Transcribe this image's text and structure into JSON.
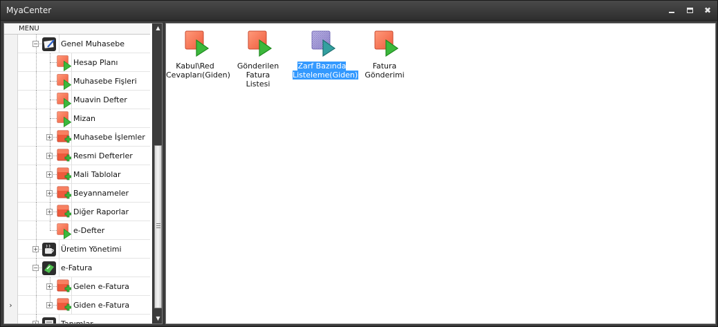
{
  "window": {
    "title": "MyaCenter",
    "minimize_glyph": "minimize-icon",
    "maximize_glyph": "maximize-icon",
    "close_glyph": "✖"
  },
  "sidebar": {
    "header": "MENU",
    "current_row_marker": "›",
    "items": [
      {
        "label": "Genel Muhasebe",
        "level": 0,
        "icon": "ledger-module-icon",
        "expander": "−"
      },
      {
        "label": "Hesap Planı",
        "level": 1,
        "icon": "form-play-icon"
      },
      {
        "label": "Muhasebe Fişleri",
        "level": 1,
        "icon": "form-play-icon"
      },
      {
        "label": "Muavin Defter",
        "level": 1,
        "icon": "form-play-icon"
      },
      {
        "label": "Mizan",
        "level": 1,
        "icon": "form-play-icon"
      },
      {
        "label": "Muhasebe İşlemler",
        "level": 1,
        "icon": "folder-plus-icon",
        "expander": "+"
      },
      {
        "label": "Resmi Defterler",
        "level": 1,
        "icon": "folder-plus-icon",
        "expander": "+"
      },
      {
        "label": "Mali Tablolar",
        "level": 1,
        "icon": "folder-plus-icon",
        "expander": "+"
      },
      {
        "label": "Beyannameler",
        "level": 1,
        "icon": "folder-plus-icon",
        "expander": "+"
      },
      {
        "label": "Diğer Raporlar",
        "level": 1,
        "icon": "folder-plus-icon",
        "expander": "+"
      },
      {
        "label": "e-Defter",
        "level": 1,
        "icon": "form-play-icon"
      },
      {
        "label": "Üretim Yönetimi",
        "level": 0,
        "icon": "production-module-icon",
        "expander": "+"
      },
      {
        "label": "e-Fatura",
        "level": 0,
        "icon": "efatura-module-icon",
        "expander": "−"
      },
      {
        "label": "Gelen e-Fatura",
        "level": 1,
        "icon": "folder-plus-icon",
        "expander": "+"
      },
      {
        "label": "Giden  e-Fatura",
        "level": 1,
        "icon": "folder-plus-icon",
        "expander": "+"
      },
      {
        "label": "Tanımlar",
        "level": 0,
        "icon": "definitions-module-icon",
        "expander": "+"
      }
    ]
  },
  "content": {
    "tiles": [
      {
        "label_line1": "Kabul\\Red",
        "label_line2": "Cevapları(Giden)",
        "icon": "form-play-icon",
        "selected": false
      },
      {
        "label_line1": "Gönderilen Fatura",
        "label_line2": "Listesi",
        "icon": "form-play-icon",
        "selected": false
      },
      {
        "label_line1": "Zarf Bazında",
        "label_line2": "Listeleme(Giden)",
        "icon": "form-play-icon",
        "selected": true
      },
      {
        "label_line1": "Fatura Gönderimi",
        "label_line2": "",
        "icon": "form-play-icon",
        "selected": false
      }
    ]
  },
  "colors": {
    "form_red": "#ee5a3c",
    "play_green": "#3cb83c",
    "selection_blue": "#3399ff",
    "titlebar_dark": "#2e2e2e"
  }
}
